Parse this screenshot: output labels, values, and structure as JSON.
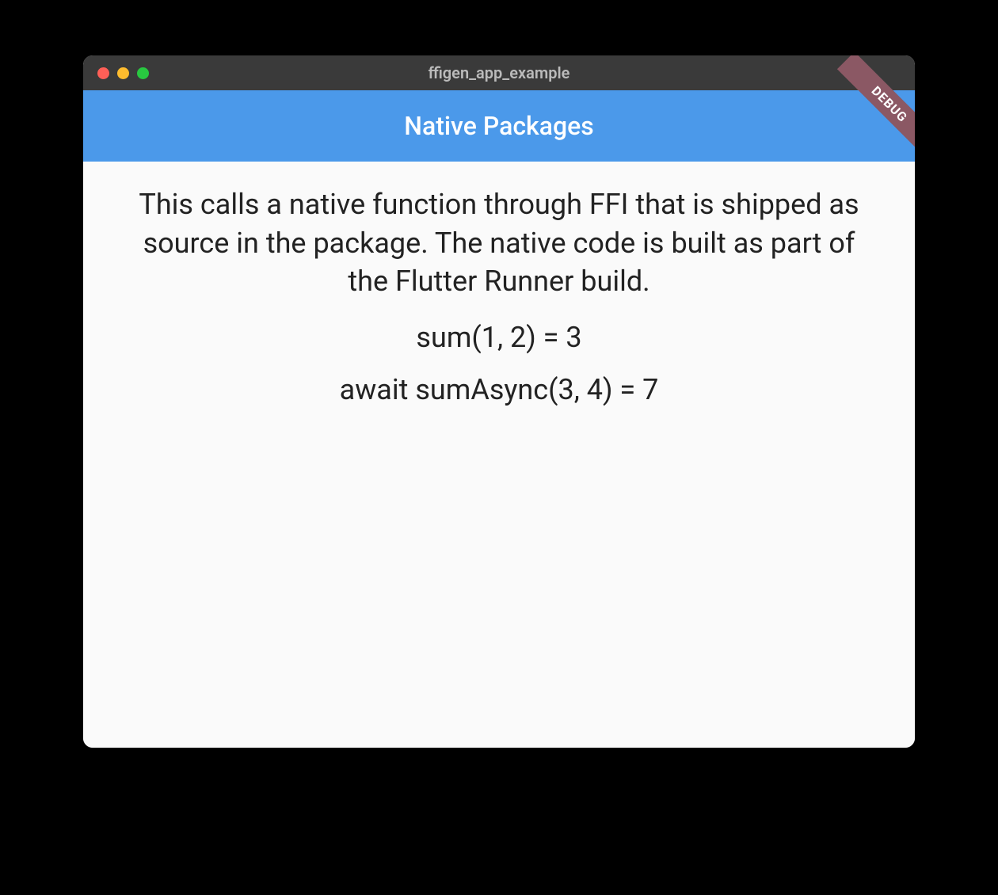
{
  "window": {
    "title": "ffigen_app_example"
  },
  "appbar": {
    "title": "Native Packages",
    "debug_banner": "DEBUG"
  },
  "content": {
    "description": "This calls a native function through FFI that is shipped as source in the package. The native code is built as part of the Flutter Runner build.",
    "sum_result": "sum(1, 2) = 3",
    "sum_async_result": "await sumAsync(3, 4) = 7"
  },
  "colors": {
    "appbar_bg": "#4b99ea",
    "content_bg": "#fafafa",
    "titlebar_bg": "#3a3a3a",
    "debug_banner_bg": "#8b5864"
  }
}
